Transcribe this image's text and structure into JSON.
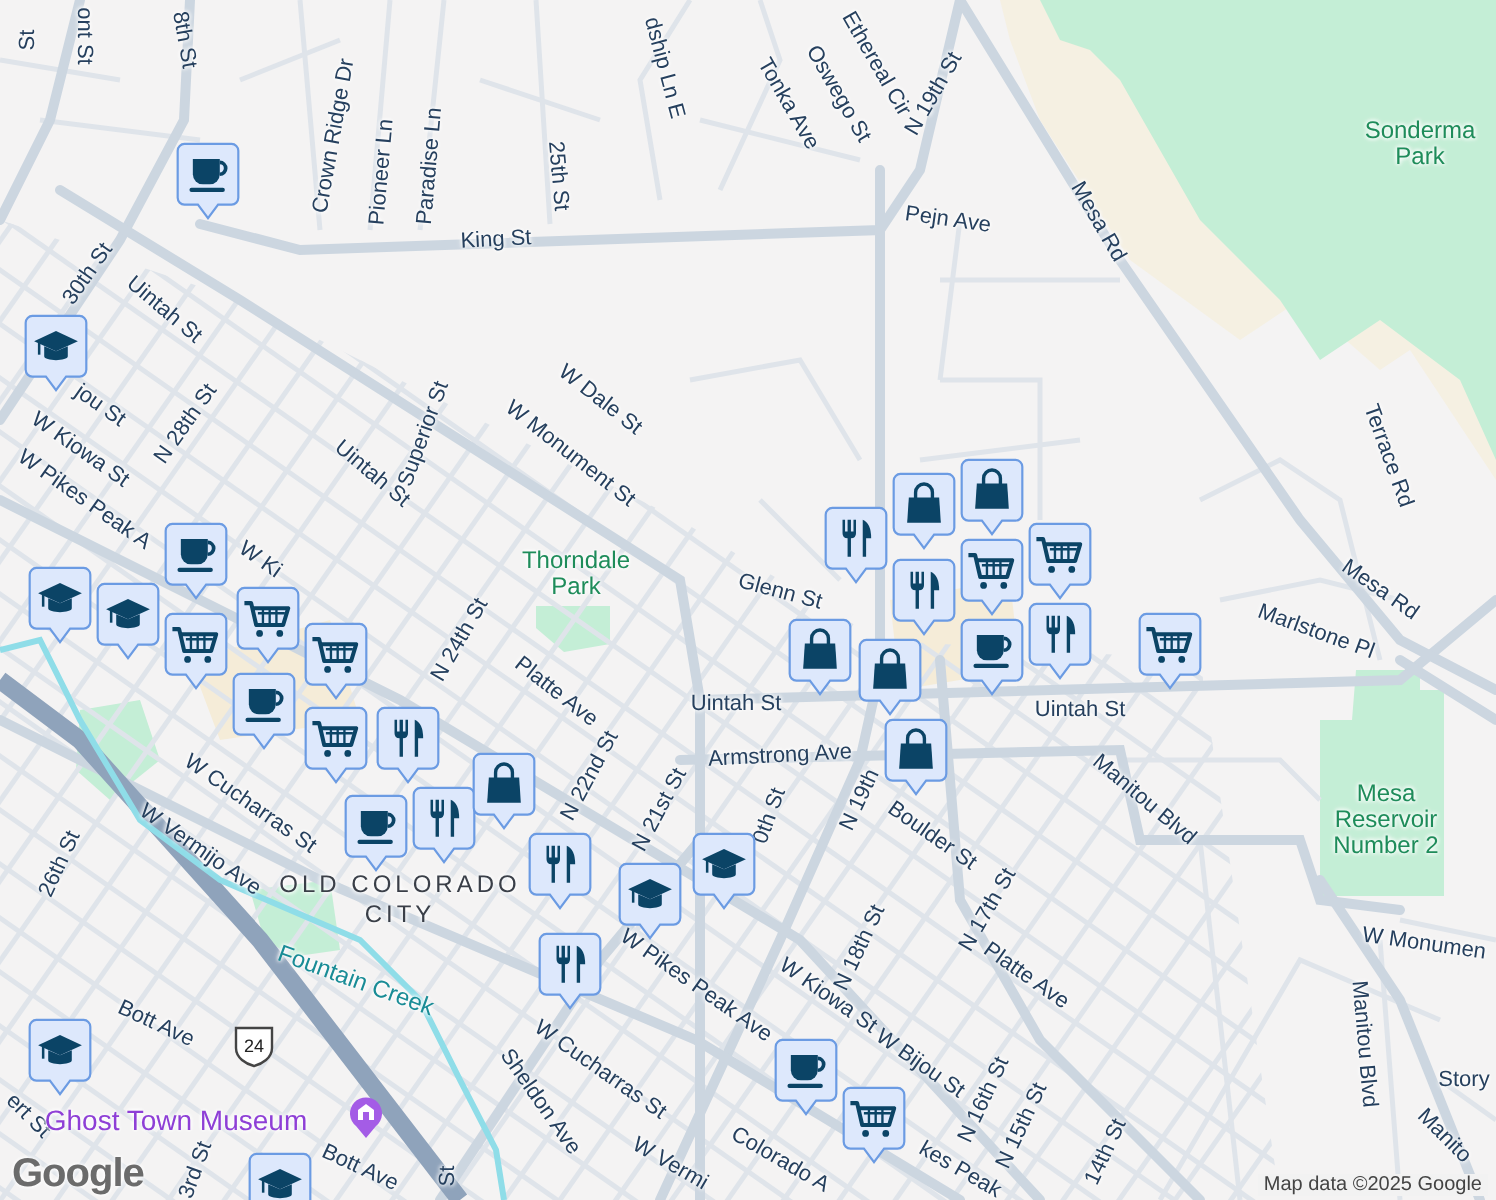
{
  "map": {
    "labels": [
      {
        "text": "St",
        "kind": "street"
      },
      {
        "text": "ont St",
        "kind": "street"
      },
      {
        "text": "8th St",
        "kind": "street"
      },
      {
        "text": "Crown Ridge Dr",
        "kind": "street"
      },
      {
        "text": "Pioneer Ln",
        "kind": "street"
      },
      {
        "text": "Paradise Ln",
        "kind": "street"
      },
      {
        "text": "25th St",
        "kind": "street"
      },
      {
        "text": "dship Ln E",
        "kind": "street"
      },
      {
        "text": "Tonka Ave",
        "kind": "street"
      },
      {
        "text": "Oswego St",
        "kind": "street"
      },
      {
        "text": "Ethereal Cir",
        "kind": "street"
      },
      {
        "text": "N 19th St",
        "kind": "street"
      },
      {
        "text": "Sonderma Park",
        "kind": "park"
      },
      {
        "text": "King St",
        "kind": "street"
      },
      {
        "text": "Pejn Ave",
        "kind": "street"
      },
      {
        "text": "Mesa Rd",
        "kind": "street"
      },
      {
        "text": "30th St",
        "kind": "street"
      },
      {
        "text": "Uintah St",
        "kind": "street"
      },
      {
        "text": "jou St",
        "kind": "street"
      },
      {
        "text": "W Kiowa St",
        "kind": "street"
      },
      {
        "text": "N 28th St",
        "kind": "street"
      },
      {
        "text": "Terrace Rd",
        "kind": "street"
      },
      {
        "text": "Uintah St",
        "kind": "street"
      },
      {
        "text": "Superior St",
        "kind": "street"
      },
      {
        "text": "W Dale St",
        "kind": "street"
      },
      {
        "text": "W Monument St",
        "kind": "street"
      },
      {
        "text": "W Pikes Peak A",
        "kind": "street"
      },
      {
        "text": "W Ki",
        "kind": "street"
      },
      {
        "text": "Thorndale Park",
        "kind": "park"
      },
      {
        "text": "Mesa Rd",
        "kind": "street"
      },
      {
        "text": "Glenn St",
        "kind": "street"
      },
      {
        "text": "Marlstone Pl",
        "kind": "street"
      },
      {
        "text": "N 24th St",
        "kind": "street"
      },
      {
        "text": "Platte Ave",
        "kind": "street"
      },
      {
        "text": "Uintah St",
        "kind": "street"
      },
      {
        "text": "Uintah St",
        "kind": "street"
      },
      {
        "text": "Armstrong Ave",
        "kind": "street"
      },
      {
        "text": "N 22nd St",
        "kind": "street"
      },
      {
        "text": "N 19th",
        "kind": "street"
      },
      {
        "text": "0th St",
        "kind": "street"
      },
      {
        "text": "N 21st St",
        "kind": "street"
      },
      {
        "text": "Manitou Blvd",
        "kind": "street"
      },
      {
        "text": "Mesa Reservoir Number 2",
        "kind": "park"
      },
      {
        "text": "Boulder St",
        "kind": "street"
      },
      {
        "text": "W Cucharras St",
        "kind": "street"
      },
      {
        "text": "W Vermijo Ave",
        "kind": "street"
      },
      {
        "text": "26th St",
        "kind": "street"
      },
      {
        "text": "N 17th St",
        "kind": "street"
      },
      {
        "text": "OLD COLORADO CITY",
        "kind": "district"
      },
      {
        "text": "W Monumen",
        "kind": "street"
      },
      {
        "text": "N 18th St",
        "kind": "street"
      },
      {
        "text": "Platte Ave",
        "kind": "street"
      },
      {
        "text": "Fountain Creek",
        "kind": "water"
      },
      {
        "text": "W Kiowa St",
        "kind": "street"
      },
      {
        "text": "W Pikes Peak Ave",
        "kind": "street"
      },
      {
        "text": "Bott Ave",
        "kind": "street"
      },
      {
        "text": "W Bijou St",
        "kind": "street"
      },
      {
        "text": "Manitou Blvd",
        "kind": "street"
      },
      {
        "text": "W Cucharras St",
        "kind": "street"
      },
      {
        "text": "Story",
        "kind": "street"
      },
      {
        "text": "N 16th St",
        "kind": "street"
      },
      {
        "text": "Sheldon Ave",
        "kind": "street"
      },
      {
        "text": "ert St",
        "kind": "street"
      },
      {
        "text": "Ghost Town Museum",
        "kind": "poi"
      },
      {
        "text": "N 15th St",
        "kind": "street"
      },
      {
        "text": "Manito",
        "kind": "street"
      },
      {
        "text": "14th St",
        "kind": "street"
      },
      {
        "text": "W Vermi",
        "kind": "street"
      },
      {
        "text": "Colorado A",
        "kind": "street"
      },
      {
        "text": "kes Peak",
        "kind": "street"
      },
      {
        "text": "3rd St",
        "kind": "street"
      },
      {
        "text": "Bott Ave",
        "kind": "street"
      },
      {
        "text": "St",
        "kind": "street"
      }
    ],
    "pins": [
      {
        "kind": "coffee"
      },
      {
        "kind": "school"
      },
      {
        "kind": "school"
      },
      {
        "kind": "school"
      },
      {
        "kind": "coffee"
      },
      {
        "kind": "grocery"
      },
      {
        "kind": "grocery"
      },
      {
        "kind": "grocery"
      },
      {
        "kind": "coffee"
      },
      {
        "kind": "grocery"
      },
      {
        "kind": "food"
      },
      {
        "kind": "food"
      },
      {
        "kind": "shopping"
      },
      {
        "kind": "coffee"
      },
      {
        "kind": "food"
      },
      {
        "kind": "food"
      },
      {
        "kind": "school"
      },
      {
        "kind": "school"
      },
      {
        "kind": "food"
      },
      {
        "kind": "shopping"
      },
      {
        "kind": "shopping"
      },
      {
        "kind": "grocery"
      },
      {
        "kind": "grocery"
      },
      {
        "kind": "food"
      },
      {
        "kind": "coffee"
      },
      {
        "kind": "food"
      },
      {
        "kind": "shopping"
      },
      {
        "kind": "shopping"
      },
      {
        "kind": "shopping"
      },
      {
        "kind": "grocery"
      },
      {
        "kind": "school"
      },
      {
        "kind": "coffee"
      },
      {
        "kind": "grocery"
      },
      {
        "kind": "school"
      }
    ],
    "route_shield": "24",
    "logo": "Google",
    "attribution": "Map data ©2025 Google"
  }
}
